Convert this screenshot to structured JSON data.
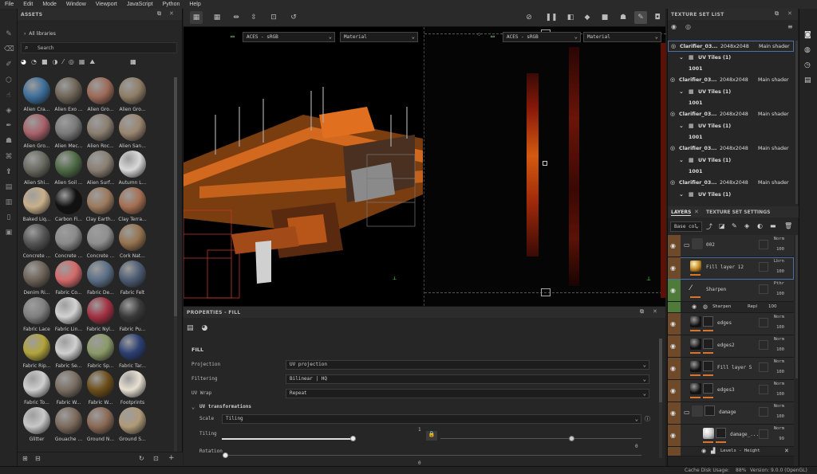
{
  "menu": {
    "file": "File",
    "edit": "Edit",
    "mode": "Mode",
    "window": "Window",
    "viewport": "Viewport",
    "javascript": "JavaScript",
    "python": "Python",
    "help": "Help"
  },
  "assets": {
    "title": "ASSETS",
    "breadcrumb": "All libraries",
    "search_placeholder": "Search",
    "items": [
      "Alien Cra...",
      "Alien Exo ...",
      "Alien Gro...",
      "Alien Gro...",
      "Alien Gro...",
      "Alien Mec...",
      "Alien Roc...",
      "Alien San...",
      "Alien Shi...",
      "Alien Soil ...",
      "Alien Surf...",
      "Autumn L...",
      "Baked Liq...",
      "Carbon Fi...",
      "Clay Earth...",
      "Clay Terra...",
      "Concrete ...",
      "Concrete ...",
      "Concrete ...",
      "Cork Nat...",
      "Denim Ri...",
      "Fabric Co...",
      "Fabric De...",
      "Fabric Felt",
      "Fabric Lace",
      "Fabric Lin...",
      "Fabric Nyl...",
      "Fabric Pu...",
      "Fabric Rip...",
      "Fabric Se...",
      "Fabric Sp...",
      "Fabric Tar...",
      "Fabric To...",
      "Fabric W...",
      "Fabric W...",
      "Footprints",
      "Glitter",
      "Gouache ...",
      "Ground N...",
      "Ground S..."
    ],
    "colors": [
      "#3d6e9a",
      "#6f6558",
      "#9c6a58",
      "#8e7d66",
      "#a8626a",
      "#7a7a7a",
      "#8a7e70",
      "#9a8570",
      "#6a6a62",
      "#4e6b45",
      "#8a7f73",
      "#d9d9d9",
      "#c8b08a",
      "#111111",
      "#9c7a5e",
      "#a56f52",
      "#555555",
      "#8a8a8a",
      "#8f8f8f",
      "#96734f",
      "#6d6257",
      "#d46a6a",
      "#5b6f86",
      "#4d5c73",
      "#7f7f7f",
      "#d2d2d2",
      "#a33142",
      "#3a3a3a",
      "#b2a43c",
      "#d0d0d0",
      "#8b9a68",
      "#2b3f73",
      "#cfcfcf",
      "#7a6e62",
      "#6d4f1a",
      "#e8e0d2",
      "#c8c8c8",
      "#7c6a5c",
      "#8a6a55",
      "#b09a78"
    ]
  },
  "viewport": {
    "colorspace_left": "ACES - sRGB",
    "material_left": "Material",
    "colorspace_right": "ACES - sRGB",
    "material_right": "Material"
  },
  "properties": {
    "title": "PROPERTIES - FILL",
    "section": "FILL",
    "projection_label": "Projection",
    "projection_value": "UV projection",
    "filtering_label": "Filtering",
    "filtering_value": "Bilinear | HQ",
    "uvwrap_label": "UV Wrap",
    "uvwrap_value": "Repeat",
    "uvtrans_label": "UV transformations",
    "scale_label": "Scale",
    "scale_value": "Tiling",
    "tiling_label": "Tiling",
    "tiling_value": "1",
    "tiling_min": "0",
    "rotation_label": "Rotation",
    "rotation_value": "0",
    "rotation_min": "0"
  },
  "texset": {
    "title": "TEXTURE SET LIST",
    "rows": [
      {
        "name": "Clarifier_03...",
        "res": "2048x2048",
        "shader": "Main shader",
        "uv": "UV Tiles (1)",
        "tile": "1001"
      },
      {
        "name": "Clarifier_03...",
        "res": "2048x2048",
        "shader": "Main shader",
        "uv": "UV Tiles (1)",
        "tile": "1001"
      },
      {
        "name": "Clarifier_03...",
        "res": "2048x2048",
        "shader": "Main shader",
        "uv": "UV Tiles (1)",
        "tile": "1001"
      },
      {
        "name": "Clarifier_03...",
        "res": "2048x2048",
        "shader": "Main shader",
        "uv": "UV Tiles (1)",
        "tile": "1001"
      },
      {
        "name": "Clarifier_03...",
        "res": "2048x2048",
        "shader": "Main shader",
        "uv": "UV Tiles (1)"
      }
    ]
  },
  "layers": {
    "tab_layers": "LAYERS",
    "tab_settings": "TEXTURE SET SETTINGS",
    "channel": "Base col",
    "items": [
      {
        "name": "002",
        "blend": "Norm",
        "opacity": "100"
      },
      {
        "name": "Fill layer 12",
        "blend": "Lbrn",
        "opacity": "100"
      },
      {
        "name": "Sharpen",
        "blend": "Pthr",
        "opacity": "100"
      },
      {
        "name": "edges",
        "blend": "Norm",
        "opacity": "100"
      },
      {
        "name": "edges2",
        "blend": "Norm",
        "opacity": "100"
      },
      {
        "name": "Fill layer 5",
        "blend": "Norm",
        "opacity": "100"
      },
      {
        "name": "edges3",
        "blend": "Norm",
        "opacity": "100"
      },
      {
        "name": "damage",
        "blend": "Norm",
        "opacity": "100"
      },
      {
        "name": "damage_...",
        "blend": "Norm",
        "opacity": "99"
      }
    ],
    "sharpen_sub": "Sharpen",
    "sharpen_sub_blend": "Repl",
    "sharpen_sub_op": "100",
    "levels_sub": "Levels - Height"
  },
  "status": {
    "cache": "Cache Disk Usage:",
    "cache_value": "88%",
    "version": "Version: 9.0.0 (OpenGL)"
  }
}
